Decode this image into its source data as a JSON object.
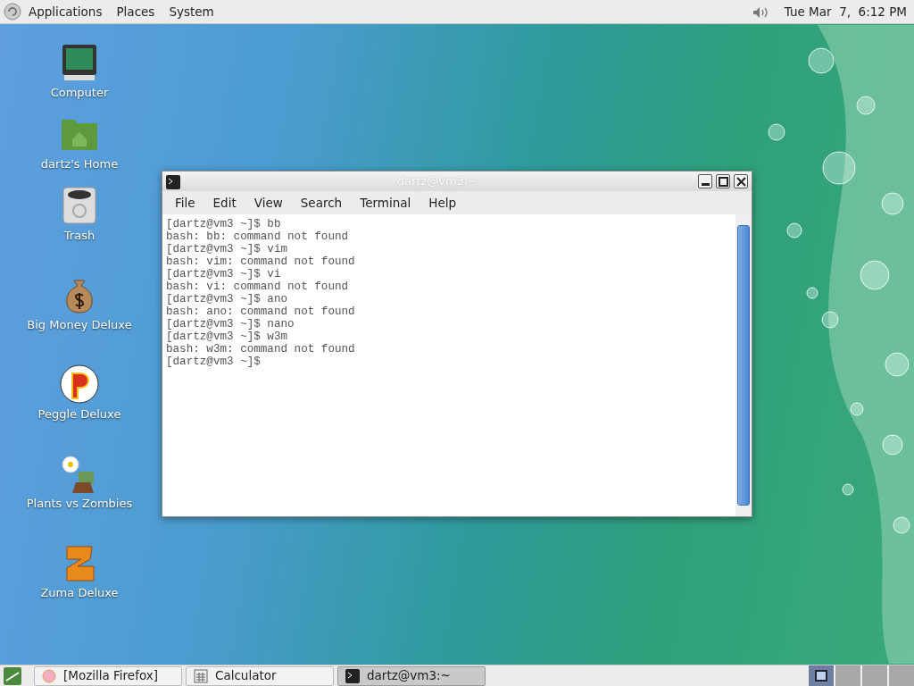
{
  "top_panel": {
    "menus": [
      "Applications",
      "Places",
      "System"
    ],
    "clock": "Tue Mar  7,  6:12 PM"
  },
  "desktop_icons": [
    {
      "label": "Computer",
      "kind": "computer"
    },
    {
      "label": "dartz's Home",
      "kind": "folder"
    },
    {
      "label": "Trash",
      "kind": "trash"
    },
    {
      "label": "Big Money Deluxe",
      "kind": "moneybag"
    },
    {
      "label": "Peggle Deluxe",
      "kind": "ball"
    },
    {
      "label": "Plants vs Zombies",
      "kind": "plant"
    },
    {
      "label": "Zuma Deluxe",
      "kind": "block"
    }
  ],
  "terminal": {
    "title": "dartz@vm3:~",
    "menus": [
      "File",
      "Edit",
      "View",
      "Search",
      "Terminal",
      "Help"
    ],
    "lines": [
      "[dartz@vm3 ~]$ bb",
      "bash: bb: command not found",
      "[dartz@vm3 ~]$ vim",
      "bash: vim: command not found",
      "[dartz@vm3 ~]$ vi",
      "bash: vi: command not found",
      "[dartz@vm3 ~]$ ano",
      "bash: ano: command not found",
      "[dartz@vm3 ~]$ nano",
      "[dartz@vm3 ~]$ w3m",
      "bash: w3m: command not found",
      "[dartz@vm3 ~]$"
    ]
  },
  "taskbar": {
    "items": [
      {
        "label": "[Mozilla Firefox]",
        "kind": "browser",
        "selected": false
      },
      {
        "label": "Calculator",
        "kind": "calculator",
        "selected": false
      },
      {
        "label": "dartz@vm3:~",
        "kind": "terminal",
        "selected": true
      }
    ],
    "workspaces": [
      {
        "selected": true
      },
      {
        "selected": false
      },
      {
        "selected": false
      },
      {
        "selected": false
      }
    ]
  }
}
